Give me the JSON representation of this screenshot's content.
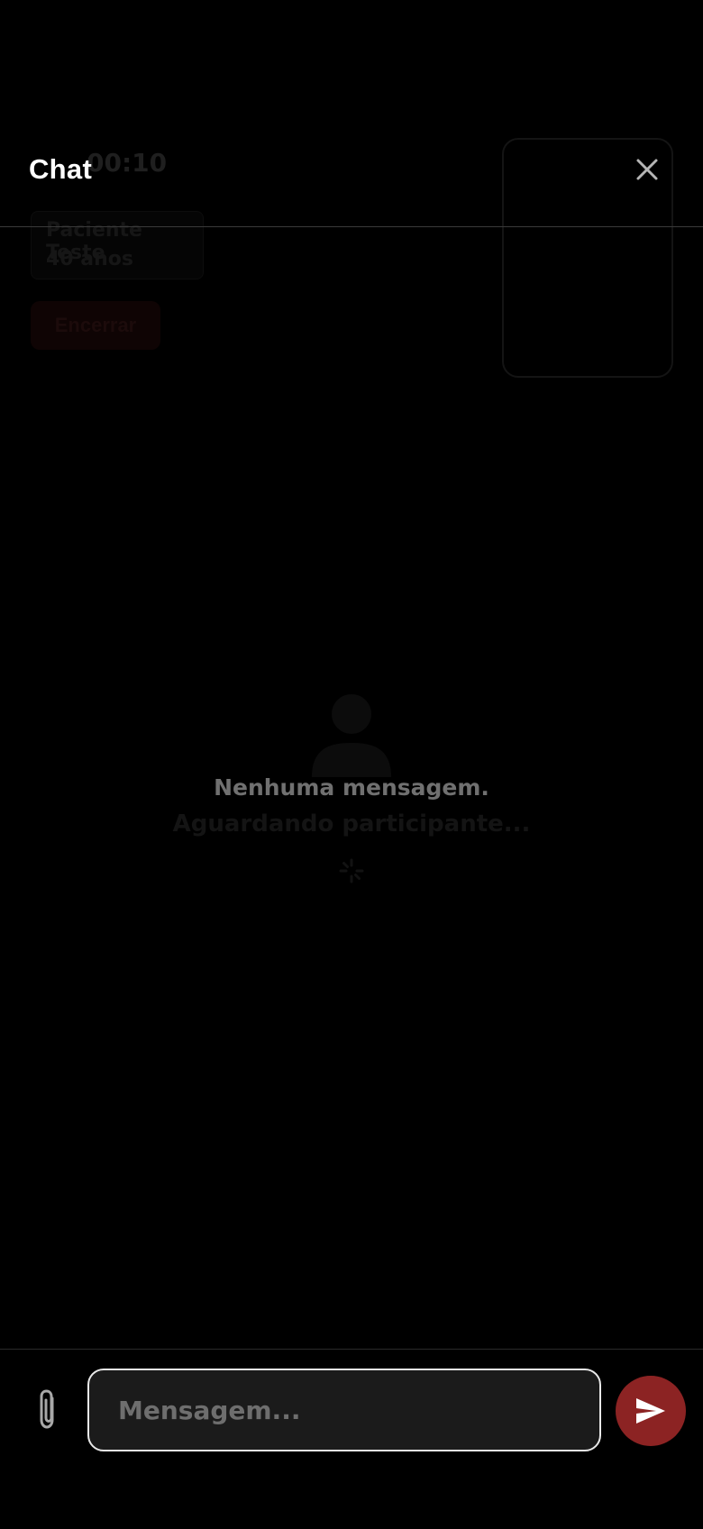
{
  "call": {
    "timer": "00:10",
    "patient_name": "Paciente Teste",
    "patient_age": "40 anos",
    "end_label": "Encerrar",
    "waiting_text": "Aguardando participante..."
  },
  "chat": {
    "title": "Chat",
    "empty_message": "Nenhuma mensagem.",
    "input": {
      "placeholder": "Mensagem...",
      "value": ""
    }
  },
  "icons": {
    "close": "close-icon",
    "attach": "paperclip-icon",
    "send": "send-icon",
    "avatar": "person-icon"
  },
  "colors": {
    "background": "#000000",
    "accent": "#8c2323",
    "input_border": "#e8e8e8",
    "input_bg": "#1b1b1b",
    "muted_text": "#707070"
  }
}
